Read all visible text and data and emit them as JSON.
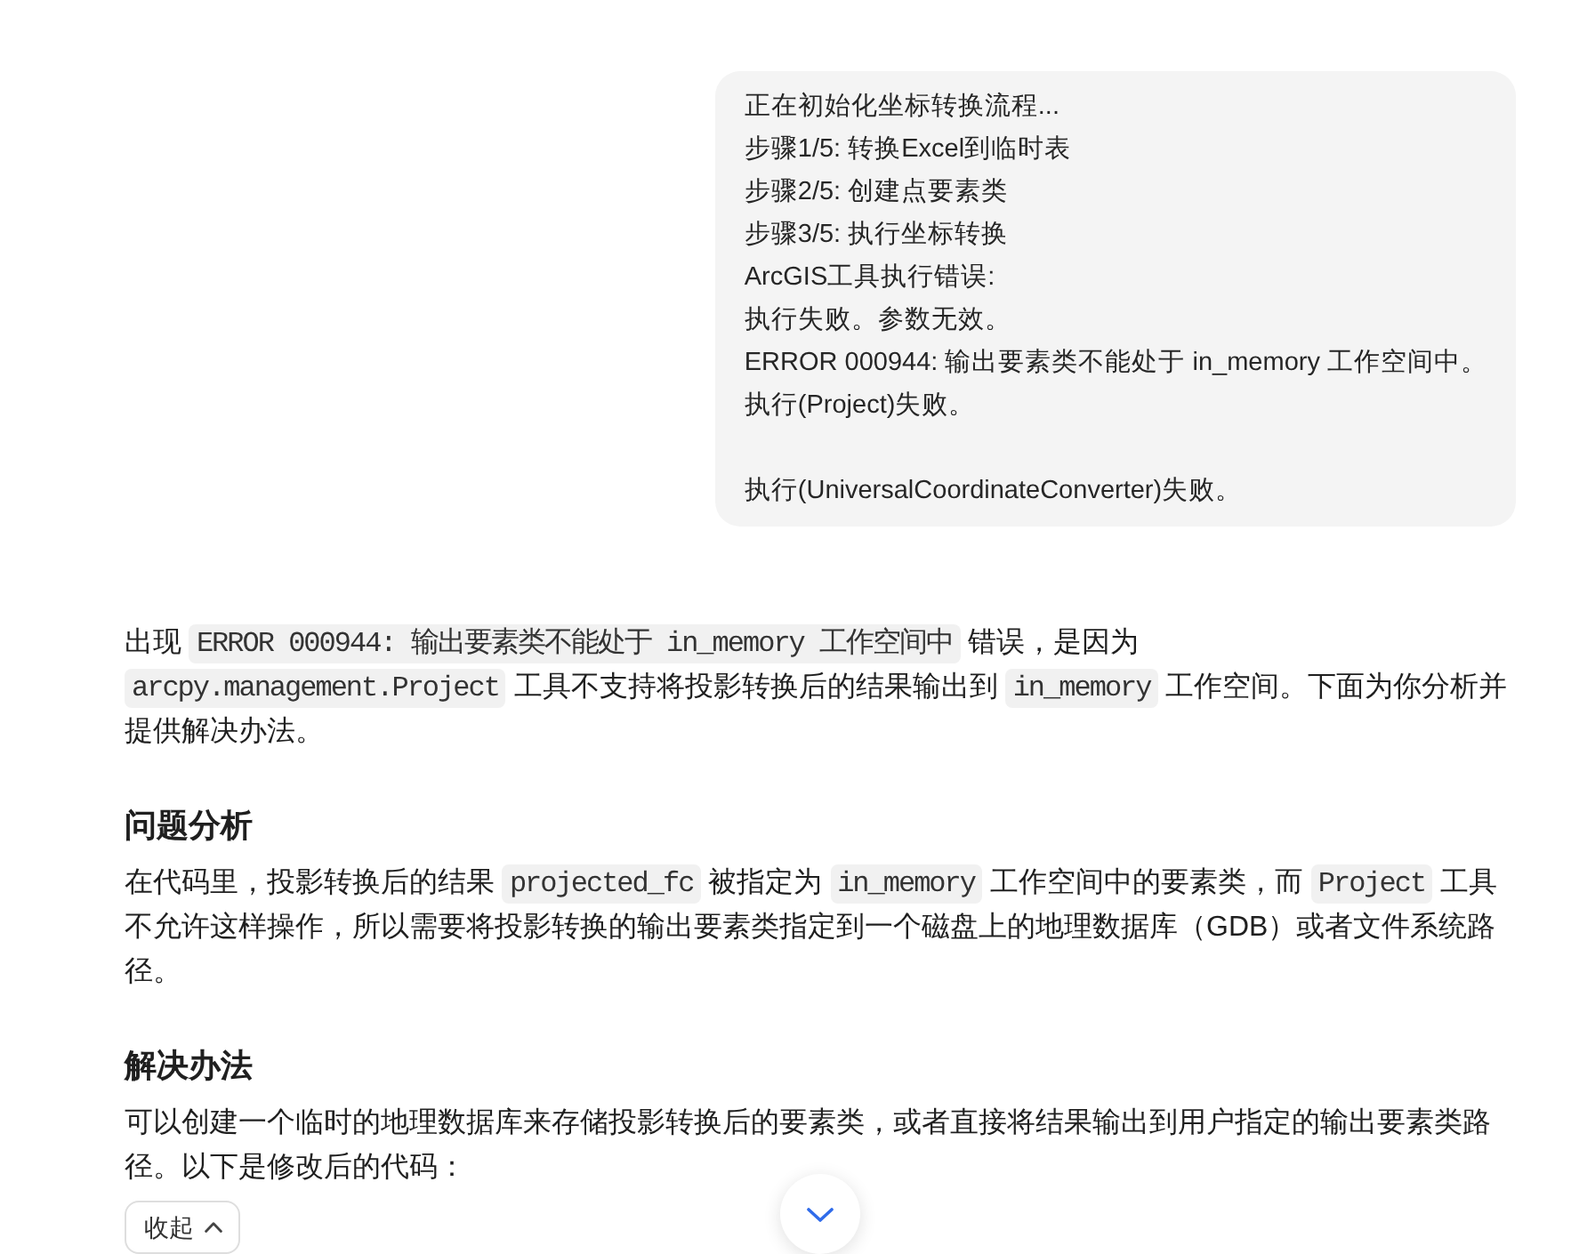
{
  "user_message": {
    "paragraphs": [
      [
        "正在初始化坐标转换流程...",
        "步骤1/5: 转换Excel到临时表",
        "步骤2/5: 创建点要素类",
        "步骤3/5: 执行坐标转换",
        "ArcGIS工具执行错误:",
        "执行失败。参数无效。",
        "ERROR 000944: 输出要素类不能处于 in_memory 工作空间中。",
        "执行(Project)失败。"
      ],
      [
        "执行(UniversalCoordinateConverter)失败。"
      ]
    ]
  },
  "answer": {
    "blocks": [
      {
        "kind": "paragraph",
        "segments": [
          {
            "kind": "text",
            "text": "出现 "
          },
          {
            "kind": "code",
            "text": "ERROR 000944: 输出要素类不能处于 in_memory 工作空间中"
          },
          {
            "kind": "text",
            "text": " 错误，是因为 "
          },
          {
            "kind": "code",
            "text": "arcpy.management.Project"
          },
          {
            "kind": "text",
            "text": " 工具不支持将投影转换后的结果输出到 "
          },
          {
            "kind": "code",
            "text": "in_memory"
          },
          {
            "kind": "text",
            "text": " 工作空间。下面为你分析并提供解决办法。"
          }
        ]
      },
      {
        "kind": "heading",
        "text": "问题分析"
      },
      {
        "kind": "paragraph",
        "segments": [
          {
            "kind": "text",
            "text": "在代码里，投影转换后的结果 "
          },
          {
            "kind": "code",
            "text": "projected_fc"
          },
          {
            "kind": "text",
            "text": " 被指定为 "
          },
          {
            "kind": "code",
            "text": "in_memory"
          },
          {
            "kind": "text",
            "text": " 工作空间中的要素类，而 "
          },
          {
            "kind": "code",
            "text": "Project"
          },
          {
            "kind": "text",
            "text": " 工具不允许这样操作，所以需要将投影转换的输出要素类指定到一个磁盘上的地理数据库（GDB）或者文件系统路径。"
          }
        ]
      },
      {
        "kind": "heading",
        "text": "解决办法"
      },
      {
        "kind": "paragraph",
        "segments": [
          {
            "kind": "text",
            "text": "可以创建一个临时的地理数据库来存储投影转换后的要素类，或者直接将结果输出到用户指定的输出要素类路径。以下是修改后的代码："
          }
        ]
      }
    ]
  },
  "collapse_button": {
    "label": "收起"
  }
}
